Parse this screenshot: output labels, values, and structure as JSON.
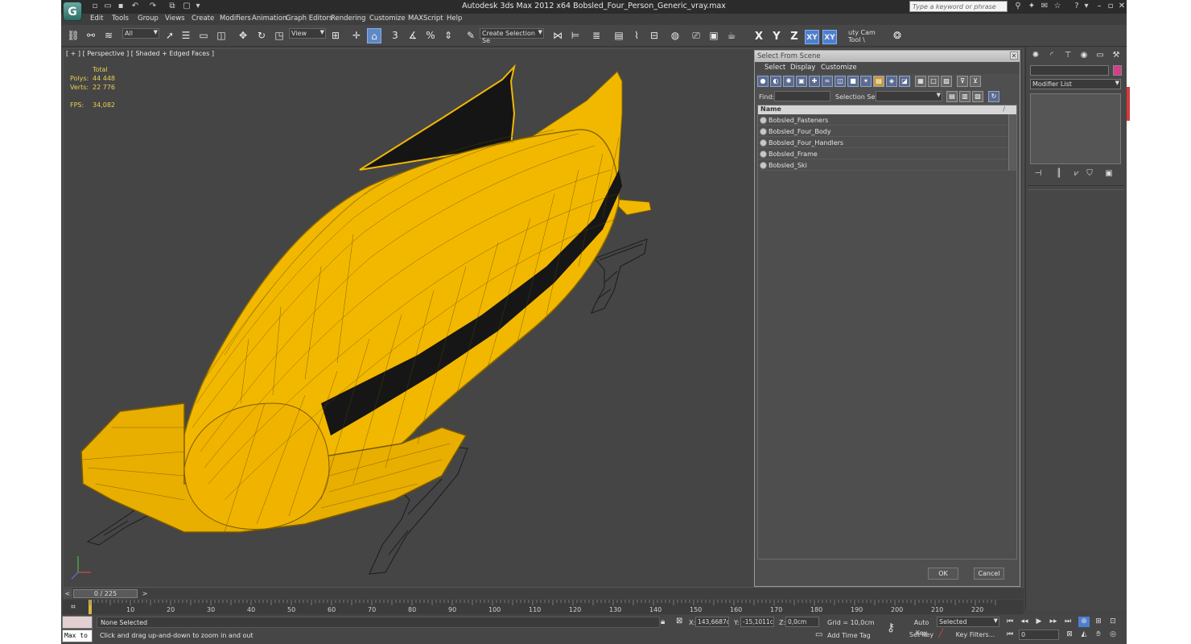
{
  "title_bar": {
    "title": "Autodesk 3ds Max  2012 x64      Bobsled_Four_Person_Generic_vray.max",
    "search_placeholder": "Type a keyword or phrase",
    "logo_glyph": "G"
  },
  "menu": [
    "Edit",
    "Tools",
    "Group",
    "Views",
    "Create",
    "Modifiers",
    "Animation",
    "Graph Editors",
    "Rendering",
    "Customize",
    "MAXScript",
    "Help"
  ],
  "toolbar": {
    "selection_filter": "All",
    "reference_coord": "View",
    "named_selection": "Create Selection Se",
    "axis_x": "X",
    "axis_y": "Y",
    "axis_z": "Z",
    "axis_xy": "XY",
    "axis_xy2": "XY",
    "cam_tool": "uty Cam Tool \\",
    "snap_3": "3",
    "snap_angle": "⁵",
    "snap_pct": "%"
  },
  "viewport": {
    "label": "[ + ] [ Perspective ] [ Shaded + Edged Faces ]",
    "stats": {
      "header": "Total",
      "polys_label": "Polys:",
      "polys_value": "44 448",
      "verts_label": "Verts:",
      "verts_value": "22 776",
      "fps_label": "FPS:",
      "fps_value": "34,082"
    }
  },
  "dialog": {
    "title": "Select From Scene",
    "menu": [
      "Select",
      "Display",
      "Customize"
    ],
    "find_label": "Find:",
    "selection_set_label": "Selection Set:",
    "column_name": "Name",
    "sort_glyph": "/",
    "items": [
      "Bobsled_Fasteners",
      "Bobsled_Four_Body",
      "Bobsled_Four_Handlers",
      "Bobsled_Frame",
      "Bobsled_Ski"
    ],
    "ok_label": "OK",
    "cancel_label": "Cancel"
  },
  "command_panel": {
    "modifier_list": "Modifier List",
    "color_swatch": "#d63c87"
  },
  "time_slider": {
    "position": "0 / 225",
    "ticks": [
      "10",
      "20",
      "30",
      "40",
      "50",
      "60",
      "70",
      "80",
      "90",
      "100",
      "110",
      "120",
      "130",
      "140",
      "150",
      "160",
      "170",
      "180",
      "190",
      "200",
      "210",
      "220"
    ]
  },
  "status": {
    "maxscript_label": "Max to",
    "selection": "None Selected",
    "prompt": "Click and drag up-and-down to zoom in and out",
    "x_label": "X:",
    "x_value": "143,6687c",
    "y_label": "Y:",
    "y_value": "-15,1011c",
    "z_label": "Z:",
    "z_value": "0,0cm",
    "grid": "Grid = 10,0cm",
    "add_time_tag": "Add Time Tag",
    "auto_key": "Auto Key",
    "set_key": "Set Key",
    "key_mode": "Selected",
    "key_filters": "Key Filters...",
    "frame": "0"
  },
  "colors": {
    "body_yellow": "#f2b800",
    "ui_dark": "#444444",
    "accent_blue": "#4d7fd1"
  }
}
